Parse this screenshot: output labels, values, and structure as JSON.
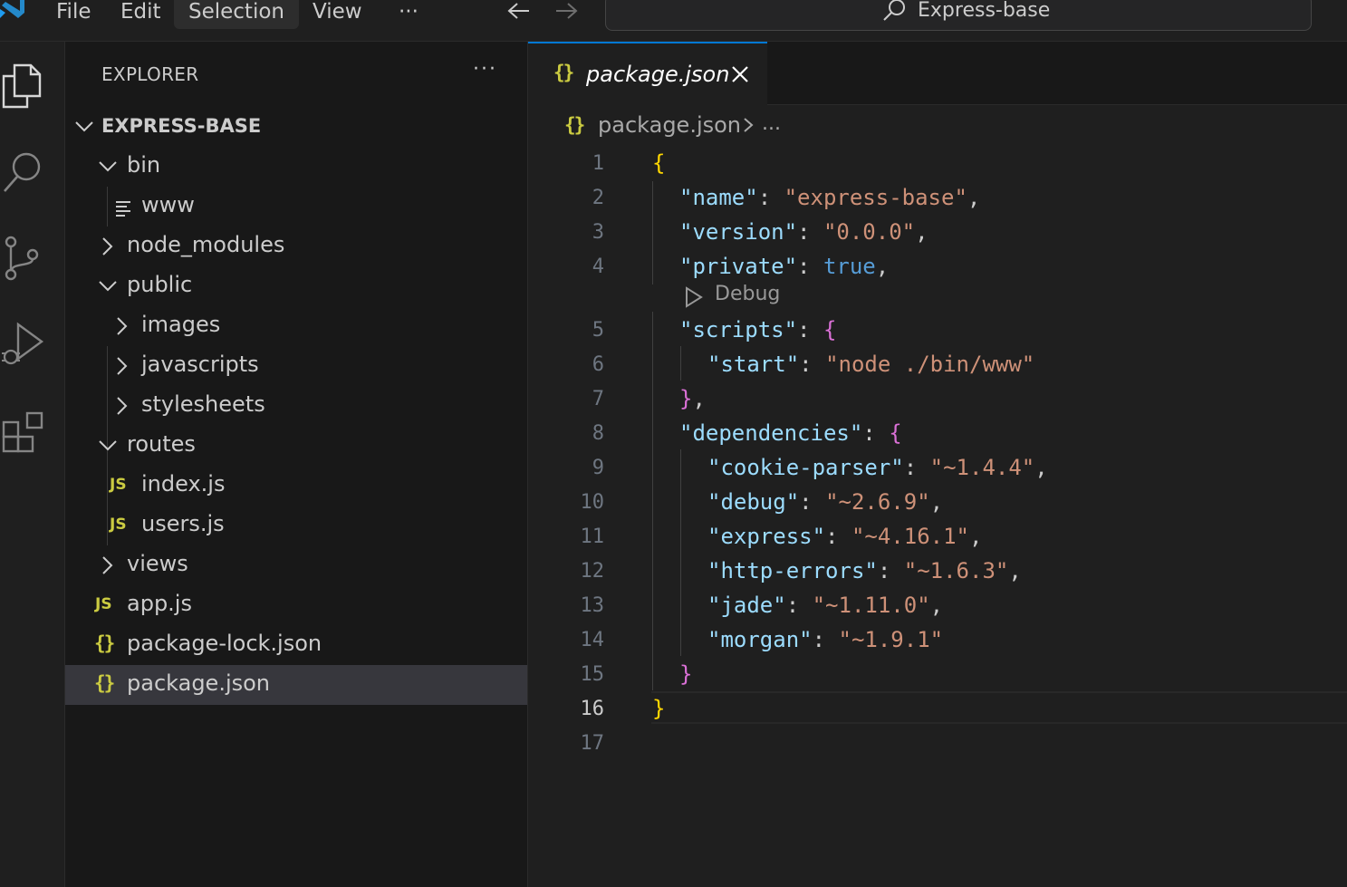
{
  "titlebar": {
    "menu": [
      "File",
      "Edit",
      "Selection",
      "View",
      "···"
    ],
    "active_menu": "Selection",
    "command_center": "Express-base"
  },
  "explorer": {
    "title": "EXPLORER",
    "more": "···",
    "root": "EXPRESS-BASE",
    "items": [
      {
        "label": "bin",
        "kind": "folder-open"
      },
      {
        "label": "www",
        "kind": "file-text"
      },
      {
        "label": "node_modules",
        "kind": "folder-closed"
      },
      {
        "label": "public",
        "kind": "folder-open"
      },
      {
        "label": "images",
        "kind": "folder-closed"
      },
      {
        "label": "javascripts",
        "kind": "folder-closed"
      },
      {
        "label": "stylesheets",
        "kind": "folder-closed"
      },
      {
        "label": "routes",
        "kind": "folder-open"
      },
      {
        "label": "index.js",
        "kind": "file-js",
        "badge": "JS"
      },
      {
        "label": "users.js",
        "kind": "file-js",
        "badge": "JS"
      },
      {
        "label": "views",
        "kind": "folder-closed"
      },
      {
        "label": "app.js",
        "kind": "file-js",
        "badge": "JS"
      },
      {
        "label": "package-lock.json",
        "kind": "file-json",
        "badge": "{}"
      },
      {
        "label": "package.json",
        "kind": "file-json",
        "badge": "{}",
        "selected": true
      }
    ]
  },
  "editor": {
    "tab": {
      "label": "package.json",
      "badge": "{}"
    },
    "breadcrumb": {
      "file": "package.json",
      "more": "..."
    },
    "codelens": "Debug",
    "current_line": 16,
    "lines": [
      {
        "n": "1",
        "code": "{"
      },
      {
        "n": "2",
        "key": "\"name\"",
        "colon": ": ",
        "value": "\"express-base\"",
        "end": ","
      },
      {
        "n": "3",
        "key": "\"version\"",
        "colon": ": ",
        "value": "\"0.0.0\"",
        "end": ","
      },
      {
        "n": "4",
        "key": "\"private\"",
        "colon": ": ",
        "value": "true",
        "end": ","
      },
      {
        "n": "5",
        "key": "\"scripts\"",
        "colon": ": ",
        "brace": "{"
      },
      {
        "n": "6",
        "key": "\"start\"",
        "colon": ": ",
        "value": "\"node ./bin/www\""
      },
      {
        "n": "7",
        "brace": "}",
        "end": ","
      },
      {
        "n": "8",
        "key": "\"dependencies\"",
        "colon": ": ",
        "brace": "{"
      },
      {
        "n": "9",
        "key": "\"cookie-parser\"",
        "colon": ": ",
        "value": "\"~1.4.4\"",
        "end": ","
      },
      {
        "n": "10",
        "key": "\"debug\"",
        "colon": ": ",
        "value": "\"~2.6.9\"",
        "end": ","
      },
      {
        "n": "11",
        "key": "\"express\"",
        "colon": ": ",
        "value": "\"~4.16.1\"",
        "end": ","
      },
      {
        "n": "12",
        "key": "\"http-errors\"",
        "colon": ": ",
        "value": "\"~1.6.3\"",
        "end": ","
      },
      {
        "n": "13",
        "key": "\"jade\"",
        "colon": ": ",
        "value": "\"~1.11.0\"",
        "end": ","
      },
      {
        "n": "14",
        "key": "\"morgan\"",
        "colon": ": ",
        "value": "\"~1.9.1\""
      },
      {
        "n": "15",
        "brace": "}"
      },
      {
        "n": "16",
        "code": "}"
      },
      {
        "n": "17",
        "code": ""
      }
    ]
  },
  "colors": {
    "accent": "#0078d4",
    "json_badge": "#cbcb41",
    "key": "#9cdcfe",
    "string": "#ce9178",
    "boolean": "#569cd6",
    "bracket_level1": "#ffd700",
    "bracket_level2": "#da70d6"
  }
}
